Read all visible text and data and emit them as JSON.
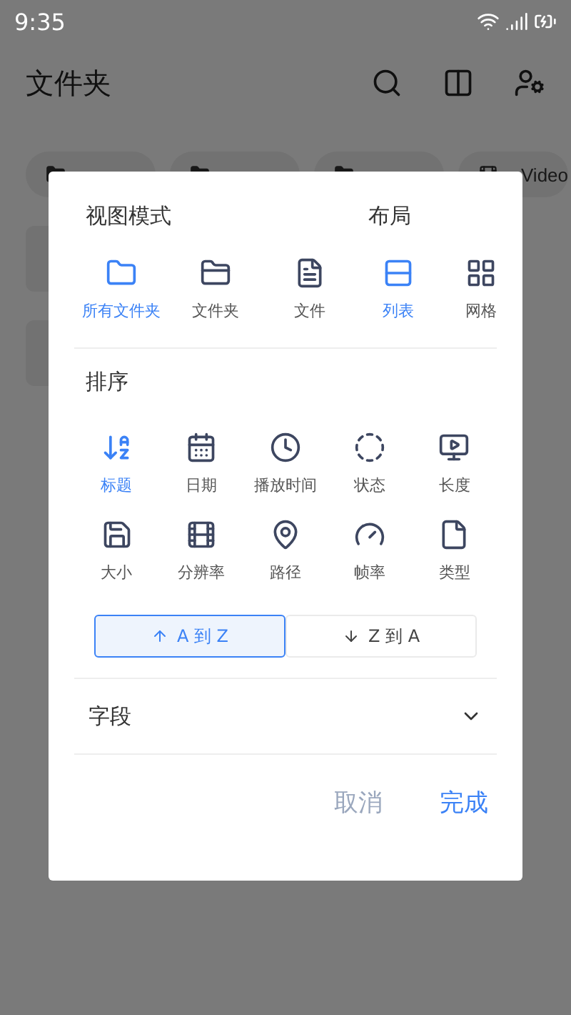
{
  "status_bar": {
    "time": "9:35"
  },
  "app_bar": {
    "title": "文件夹"
  },
  "chips": [
    {
      "kind": "folder"
    },
    {
      "kind": "folder"
    },
    {
      "kind": "folder"
    },
    {
      "kind": "video",
      "label": "Video"
    }
  ],
  "dialog": {
    "view_mode": {
      "title": "视图模式",
      "items": [
        {
          "label": "所有文件夹",
          "selected": true
        },
        {
          "label": "文件夹",
          "selected": false
        },
        {
          "label": "文件",
          "selected": false
        }
      ]
    },
    "layout": {
      "title": "布局",
      "items": [
        {
          "label": "列表",
          "selected": true
        },
        {
          "label": "网格",
          "selected": false
        }
      ]
    },
    "sort": {
      "title": "排序",
      "items": [
        {
          "label": "标题",
          "selected": true
        },
        {
          "label": "日期",
          "selected": false
        },
        {
          "label": "播放时间",
          "selected": false
        },
        {
          "label": "状态",
          "selected": false
        },
        {
          "label": "长度",
          "selected": false
        },
        {
          "label": "大小",
          "selected": false
        },
        {
          "label": "分辨率",
          "selected": false
        },
        {
          "label": "路径",
          "selected": false
        },
        {
          "label": "帧率",
          "selected": false
        },
        {
          "label": "类型",
          "selected": false
        }
      ],
      "directions": [
        {
          "label": "A 到 Z",
          "selected": true
        },
        {
          "label": "Z 到 A",
          "selected": false
        }
      ]
    },
    "fields": {
      "label": "字段",
      "expanded": false
    },
    "buttons": [
      {
        "label": "取消",
        "kind": "secondary"
      },
      {
        "label": "完成",
        "kind": "primary"
      }
    ]
  }
}
